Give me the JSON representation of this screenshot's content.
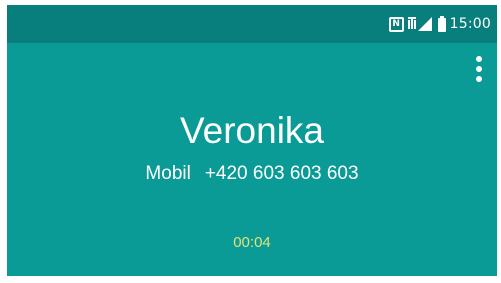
{
  "status_bar": {
    "time": "15:00",
    "icons": [
      "nfc-icon",
      "signal-icon",
      "battery-icon"
    ]
  },
  "menu": {
    "icon": "more-vert-icon"
  },
  "call": {
    "contact_name": "Veronika",
    "number_label": "Mobil",
    "phone_number": "+420 603 603 603",
    "duration": "00:04"
  },
  "colors": {
    "background": "#0a9b97",
    "status_bar": "#087f7c",
    "duration_text": "#e0e27c",
    "text": "#ffffff"
  }
}
